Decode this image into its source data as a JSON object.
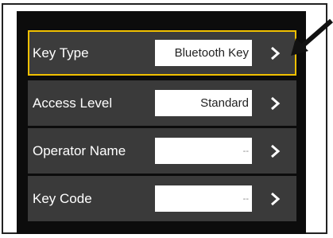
{
  "rows": [
    {
      "label": "Key Type",
      "value": "Bluetooth Key",
      "selected": true
    },
    {
      "label": "Access Level",
      "value": "Standard",
      "selected": false
    },
    {
      "label": "Operator Name",
      "value": "--",
      "selected": false
    },
    {
      "label": "Key Code",
      "value": "--",
      "selected": false
    }
  ],
  "colors": {
    "selection_border": "#f0c000",
    "panel_background": "#0c0c0c",
    "row_background": "#3a3a3a"
  },
  "icons": {
    "row_action": "chevron-right-icon",
    "callout": "pointer-arrow-icon"
  }
}
